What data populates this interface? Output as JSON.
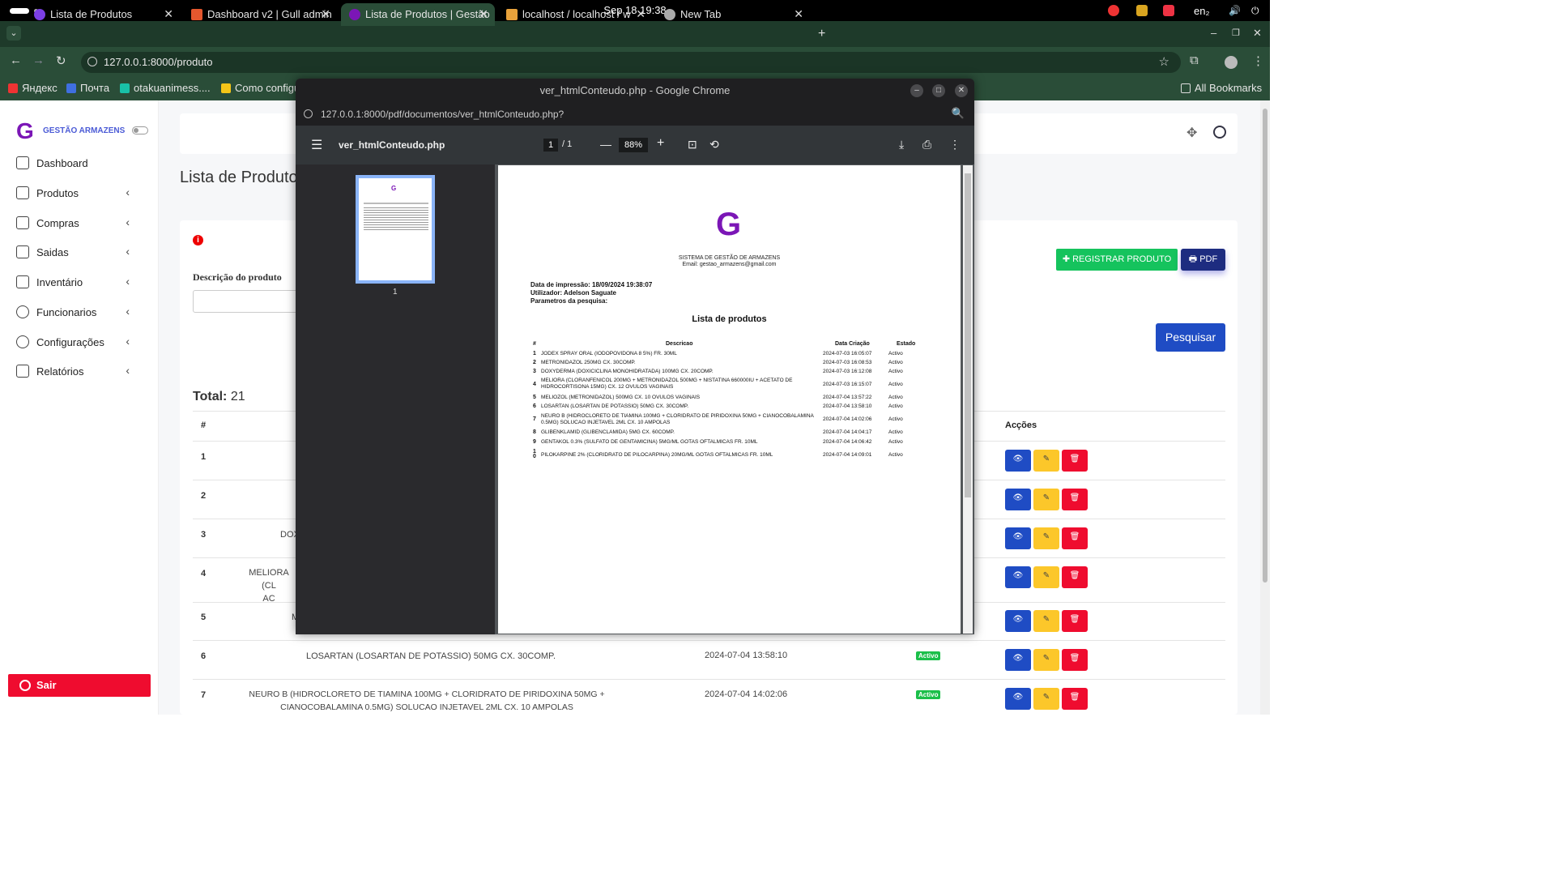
{
  "system": {
    "clock": "Sep 18  19:38",
    "lang": "en₂"
  },
  "tabs": [
    {
      "label": "Lista de Produtos",
      "color": "#7b3fe4"
    },
    {
      "label": "Dashboard v2 | Gull admin",
      "color": "#e4572e"
    },
    {
      "label": "Lista de Produtos | Gestão",
      "color": "#7b16b6"
    },
    {
      "label": "localhost / localhost / w",
      "color": "#e9a23b"
    },
    {
      "label": "New Tab",
      "color": "#aaaaaa"
    }
  ],
  "address": {
    "url": "127.0.0.1:8000/produto"
  },
  "bookmarks": [
    "Яндекс",
    "Почта",
    "otakuanimess....",
    "Como configu",
    "All Bookmarks"
  ],
  "sidebar": {
    "logo": "G",
    "brand": "GESTÃO ARMAZENS",
    "items": [
      "Dashboard",
      "Produtos",
      "Compras",
      "Saidas",
      "Inventário",
      "Funcionarios",
      "Configurações",
      "Relatórios"
    ],
    "logout": "Sair"
  },
  "main": {
    "page_title": "Lista de Produtos",
    "desc_label": "Descrição do produto",
    "register_btn": "✚ REGISTRAR PRODUTO",
    "pdf_btn": "🖶 PDF",
    "search_btn": "Pesquisar",
    "total_label": "Total:",
    "total_value": "21",
    "col_num": "#",
    "col_actions": "Acções",
    "rows": [
      {
        "n": "1",
        "desc": "",
        "date": "",
        "status": ""
      },
      {
        "n": "2",
        "desc": "",
        "date": "",
        "status": ""
      },
      {
        "n": "3",
        "desc": "DOX",
        "date": "",
        "status": ""
      },
      {
        "n": "4",
        "desc": "MELIORA (CL\nAC",
        "date": "",
        "status": ""
      },
      {
        "n": "5",
        "desc": "M",
        "date": "",
        "status": ""
      },
      {
        "n": "6",
        "desc": "LOSARTAN (LOSARTAN DE POTASSIO) 50MG CX. 30COMP.",
        "date": "2024-07-04 13:58:10",
        "status": "Activo"
      },
      {
        "n": "7",
        "desc": "NEURO B (HIDROCLORETO DE TIAMINA 100MG + CLORIDRATO DE PIRIDOXINA 50MG +\nCIANOCOBALAMINA 0.5MG) SOLUCAO INJETAVEL 2ML CX. 10 AMPOLAS",
        "date": "2024-07-04 14:02:06",
        "status": "Activo"
      }
    ]
  },
  "popup": {
    "window_title": "ver_htmlConteudo.php - Google Chrome",
    "url": "127.0.0.1:8000/pdf/documentos/ver_htmlConteudo.php?",
    "file_name": "ver_htmlConteudo.php",
    "page_current": "1",
    "page_total": "/  1",
    "zoom": "88%",
    "thumb_label": "1"
  },
  "pdf": {
    "logo": "G",
    "system_name": "SISTEMA DE GESTÃO DE ARMAZENS",
    "email": "Email: gestao_armazens@gmail.com",
    "print_date": "Data de impressão: 18/09/2024 19:38:07",
    "user": "Utilizador: Adelson Saguate",
    "params": "Parametros da pesquisa:",
    "title": "Lista de produtos",
    "headers": {
      "num": "#",
      "desc": "Descricao",
      "date": "Data Criação",
      "status": "Estado"
    },
    "rows": [
      {
        "n": "1",
        "desc": "JODEX SPRAY ORAL (IODOPOVIDONA 8 5%) FR. 30ML",
        "date": "2024-07-03 16:05:07",
        "status": "Activo"
      },
      {
        "n": "2",
        "desc": "METRONIDAZOL 250MG CX. 30COMP.",
        "date": "2024-07-03 16:08:53",
        "status": "Activo"
      },
      {
        "n": "3",
        "desc": "DOXYDERMA (DOXICICLINA MONOHIDRATADA) 100MG CX. 20COMP.",
        "date": "2024-07-03 16:12:08",
        "status": "Activo"
      },
      {
        "n": "4",
        "desc": "MELIORA (CLORANFENICOL 200MG + METRONIDAZOL 500MG + NISTATINA 660000IU + ACETATO DE HIDROCORTISONA 15MG) CX. 12 OVULOS VAGINAIS",
        "date": "2024-07-03 16:15:07",
        "status": "Activo"
      },
      {
        "n": "5",
        "desc": "MELIOZOL (METRONIDAZOL) 500MG CX. 10 OVULOS VAGINAIS",
        "date": "2024-07-04 13:57:22",
        "status": "Activo"
      },
      {
        "n": "6",
        "desc": "LOSARTAN (LOSARTAN DE POTASSIO) 50MG CX. 30COMP.",
        "date": "2024-07-04 13:58:10",
        "status": "Activo"
      },
      {
        "n": "7",
        "desc": "NEURO B (HIDROCLORETO DE TIAMINA 100MG + CLORIDRATO DE PIRIDOXINA 50MG + CIANOCOBALAMINA 0.5MG) SOLUCAO INJETAVEL 2ML CX. 10 AMPOLAS",
        "date": "2024-07-04 14:02:06",
        "status": "Activo"
      },
      {
        "n": "8",
        "desc": "GLIBENKLAMID (GLIBENCLAMIDA) 5MG CX. 60COMP.",
        "date": "2024-07-04 14:04:17",
        "status": "Activo"
      },
      {
        "n": "9",
        "desc": "GENTAKOL 0.3% (SULFATO DE GENTAMICINA) 5MG/ML GOTAS OFTALMICAS FR. 10ML",
        "date": "2024-07-04 14:06:42",
        "status": "Activo"
      },
      {
        "n": "10",
        "desc": "PILOKARPINE 2% (CLORIDRATO DE PILOCARPINA) 20MG/ML GOTAS OFTALMICAS FR. 10ML",
        "date": "2024-07-04 14:09:01",
        "status": "Activo"
      }
    ]
  }
}
